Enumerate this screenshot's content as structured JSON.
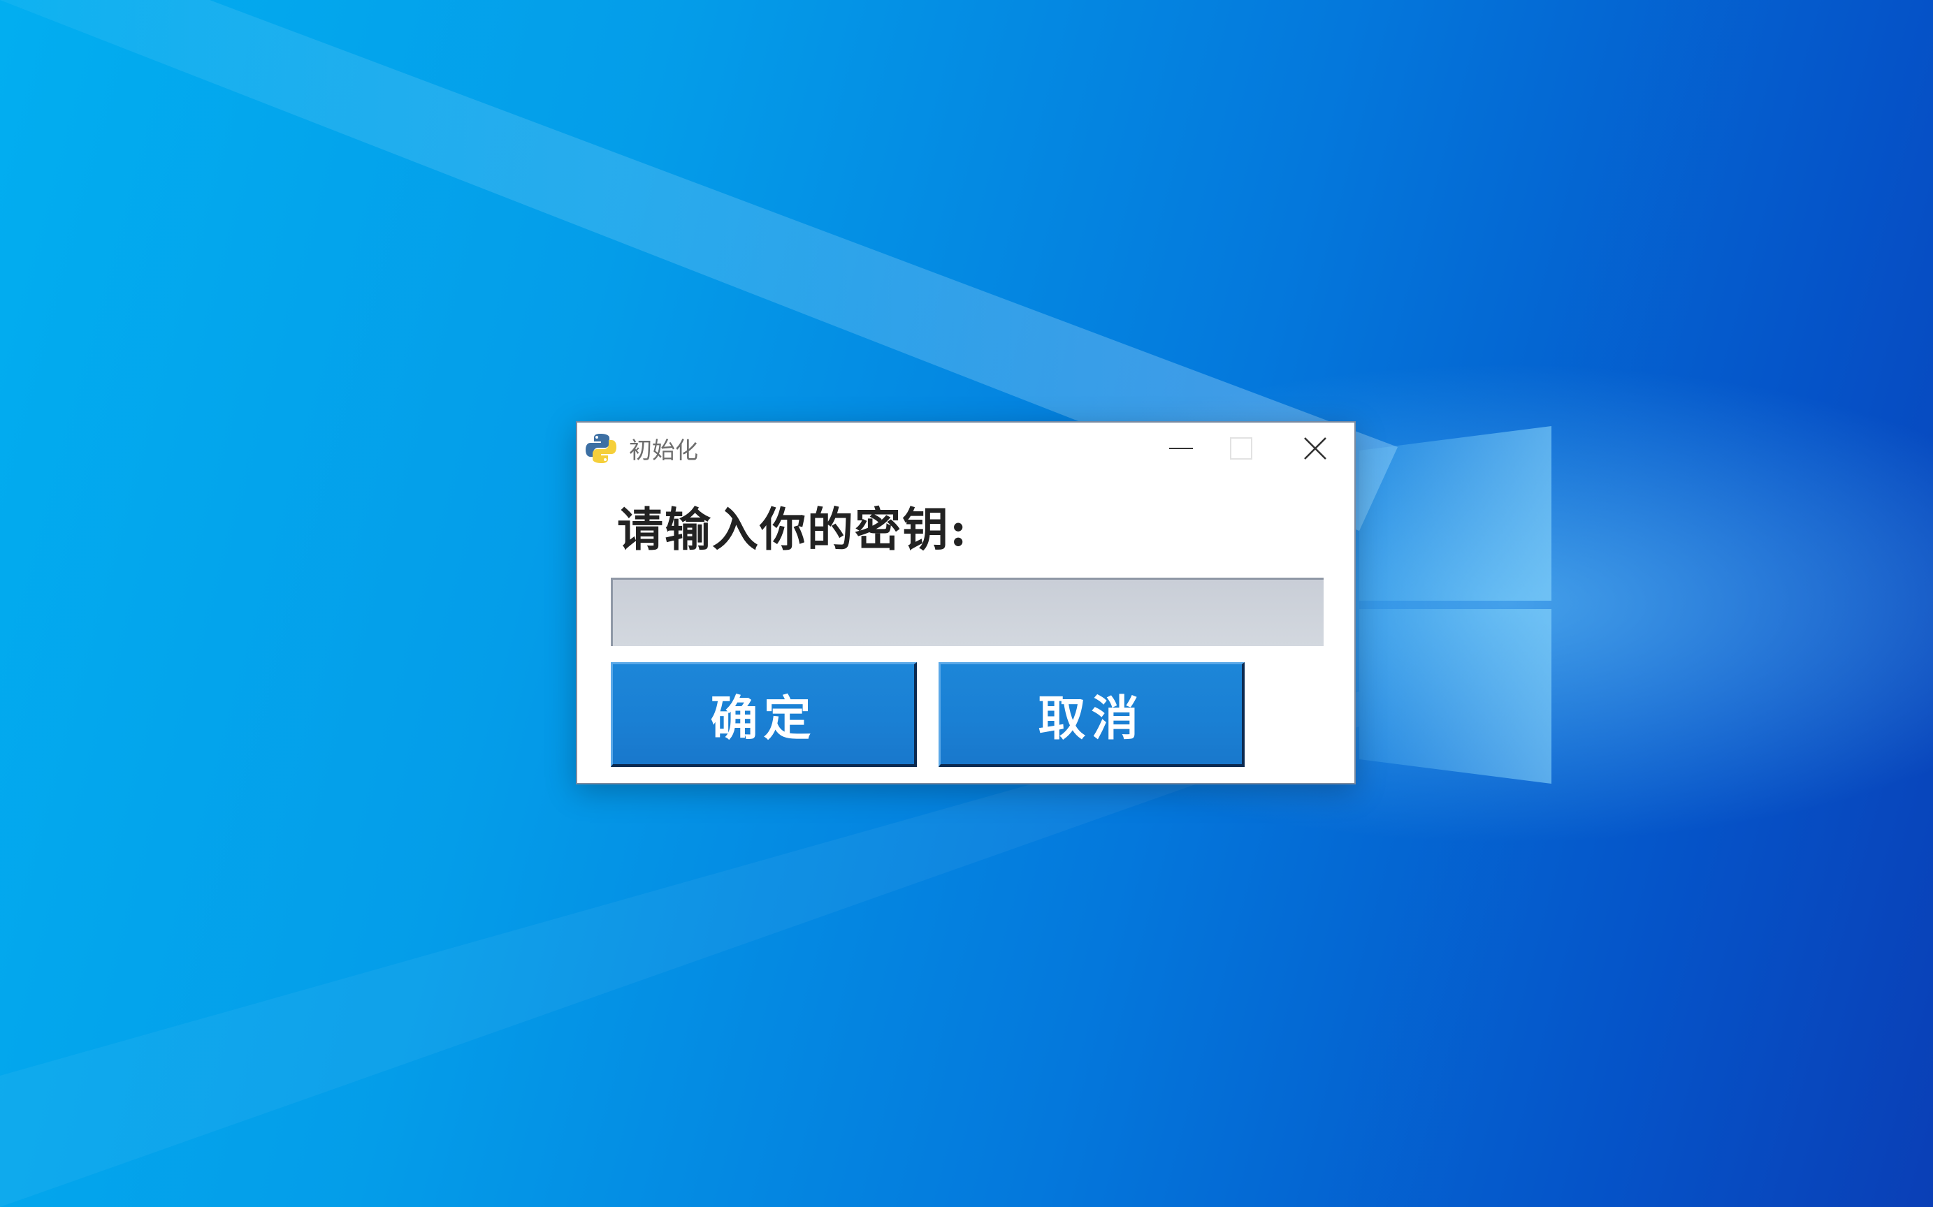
{
  "window": {
    "title": "初始化",
    "app_icon": "python-icon",
    "controls": {
      "minimize_icon": "minimize-icon",
      "maximize_icon": "maximize-icon",
      "close_icon": "close-icon"
    }
  },
  "form": {
    "prompt": "请输入你的密钥:",
    "key_input": {
      "value": "",
      "placeholder": ""
    },
    "confirm_label": "确定",
    "cancel_label": "取消"
  },
  "colors": {
    "button_blue": "#1a80d4",
    "input_bg": "#cdd2da",
    "desktop_blue": "#0478dc"
  }
}
